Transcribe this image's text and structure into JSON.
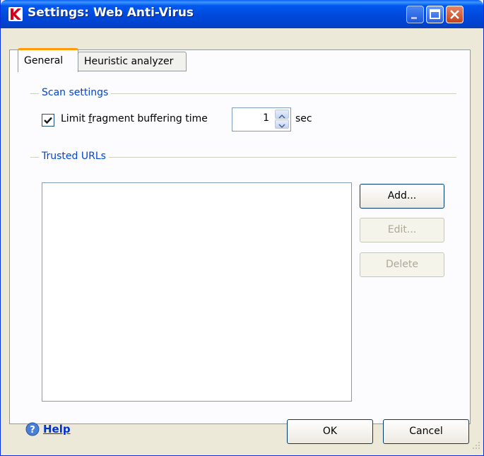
{
  "window": {
    "title": "Settings: Web Anti-Virus"
  },
  "tabs": [
    {
      "label": "General",
      "active": true
    },
    {
      "label": "Heuristic analyzer",
      "active": false
    }
  ],
  "scan_settings": {
    "group_label": "Scan settings",
    "limit_checkbox_checked": true,
    "limit_label_prefix": "Limit ",
    "limit_label_accel": "f",
    "limit_label_suffix": "ragment buffering time",
    "value": "1",
    "unit": "sec"
  },
  "trusted_urls": {
    "group_label": "Trusted URLs",
    "items": [],
    "add_label": "Add...",
    "edit_label": "Edit...",
    "delete_label": "Delete"
  },
  "footer": {
    "help_label": "Help",
    "ok_label": "OK",
    "cancel_label": "Cancel"
  },
  "colors": {
    "titlebar": "#0054e3",
    "group_label": "#0046d5",
    "active_tab_accent": "#ff9b06",
    "close_button": "#c4431b"
  }
}
